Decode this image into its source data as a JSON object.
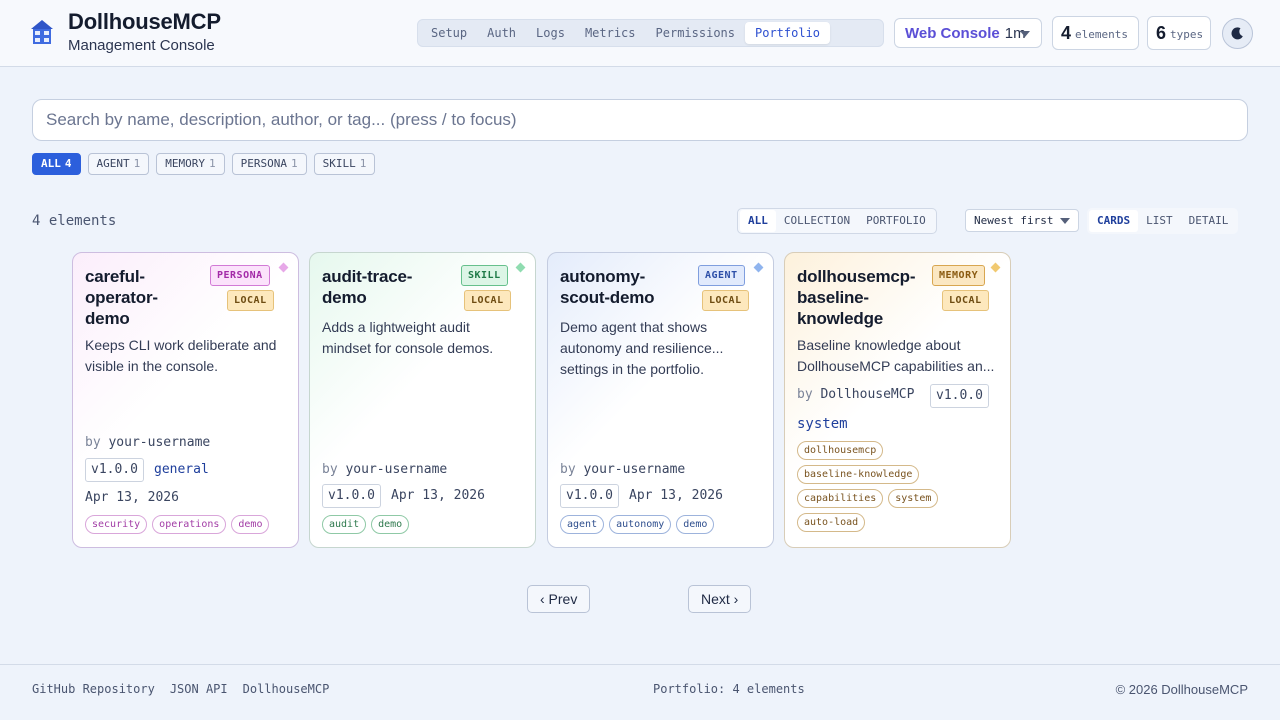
{
  "header": {
    "app_title": "DollhouseMCP",
    "app_subtitle": "Management Console",
    "tabs": [
      {
        "label": "Setup",
        "active": false
      },
      {
        "label": "Auth",
        "active": false
      },
      {
        "label": "Logs",
        "active": false
      },
      {
        "label": "Metrics",
        "active": false
      },
      {
        "label": "Permissions",
        "active": false
      },
      {
        "label": "Portfolio",
        "active": true
      }
    ],
    "console_select": {
      "name": "Web Console",
      "interval": "1m"
    },
    "stats": {
      "elements": {
        "value": "4",
        "label": "elements"
      },
      "types": {
        "value": "6",
        "label": "types"
      }
    },
    "theme_icon": "moon-icon"
  },
  "search": {
    "placeholder": "Search by name, description, author, or tag... (press / to focus)",
    "value": ""
  },
  "type_filters": [
    {
      "label": "ALL",
      "count": "4",
      "active": true
    },
    {
      "label": "AGENT",
      "count": "1",
      "active": false
    },
    {
      "label": "MEMORY",
      "count": "1",
      "active": false
    },
    {
      "label": "PERSONA",
      "count": "1",
      "active": false
    },
    {
      "label": "SKILL",
      "count": "1",
      "active": false
    }
  ],
  "toolbar": {
    "result_count": "4 elements",
    "source_options": [
      "ALL",
      "COLLECTION",
      "PORTFOLIO"
    ],
    "source_selected": "ALL",
    "sort_value": "Newest first",
    "view_options": [
      "CARDS",
      "LIST",
      "DETAIL"
    ],
    "view_selected": "CARDS"
  },
  "cards": [
    {
      "title": "careful-operator-demo",
      "title_lines": [
        "careful-",
        "operator-",
        "demo"
      ],
      "type_badge": "PERSONA",
      "source_badge": "LOCAL",
      "desc_lines": [
        "Keeps CLI work deliberate and",
        "visible in the console."
      ],
      "author_prefix": "by",
      "author": "your-username",
      "version": "v1.0.0",
      "category": "general",
      "date": "Apr 13, 2026",
      "tags": [
        "security",
        "operations",
        "demo"
      ],
      "accent": "#d24fd8"
    },
    {
      "title": "audit-trace-demo",
      "title_lines": [
        "audit-trace-",
        "demo"
      ],
      "type_badge": "SKILL",
      "source_badge": "LOCAL",
      "desc_lines": [
        "Adds a lightweight audit",
        "mindset for console demos."
      ],
      "author_prefix": "by",
      "author": "your-username",
      "version": "v1.0.0",
      "date": "Apr 13, 2026",
      "tags": [
        "audit",
        "demo"
      ],
      "accent": "#3fbf7f"
    },
    {
      "title": "autonomy-scout-demo",
      "title_lines": [
        "autonomy-",
        "scout-demo"
      ],
      "type_badge": "AGENT",
      "source_badge": "LOCAL",
      "desc_lines": [
        "Demo agent that shows",
        "autonomy and resilience...",
        "settings in the portfolio."
      ],
      "author_prefix": "by",
      "author": "your-username",
      "version": "v1.0.0",
      "date": "Apr 13, 2026",
      "tags": [
        "agent",
        "autonomy",
        "demo"
      ],
      "accent": "#5b8fe6"
    },
    {
      "title": "dollhousemcp-baseline-knowledge",
      "title_lines": [
        "dollhousemcp-",
        "baseline-",
        "knowledge"
      ],
      "type_badge": "MEMORY",
      "source_badge": "LOCAL",
      "desc_lines": [
        "Baseline knowledge about",
        "DollhouseMCP capabilities an..."
      ],
      "author_prefix": "by",
      "author": "DollhouseMCP",
      "version": "v1.0.0",
      "category": "system",
      "tags": [
        "dollhousemcp",
        "baseline-knowledge",
        "capabilities",
        "system",
        "auto-load"
      ],
      "accent": "#e9b03b"
    }
  ],
  "pagination": {
    "prev": "‹ Prev",
    "next": "Next ›"
  },
  "footer": {
    "links": [
      "GitHub Repository",
      "JSON API",
      "DollhouseMCP"
    ],
    "summary": "Portfolio: 4 elements",
    "copyright": "© 2026 DollhouseMCP"
  }
}
